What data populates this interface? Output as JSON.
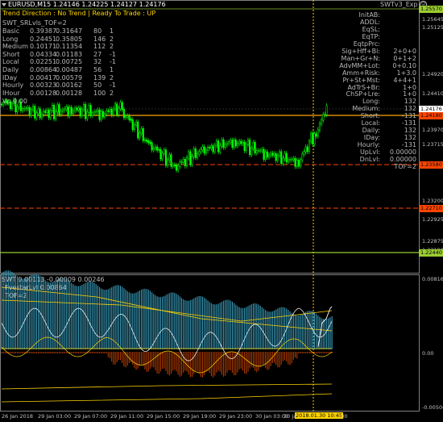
{
  "header": {
    "symbol_line": "EURUSD,M15  1.24146 1.24225 1.24127 1.24176",
    "trend_line": "Trend Direction : No Trend  |  Ready To Trade : UP",
    "indicator_name": "SWTv3_Exp",
    "swt_line": "SWT_SRLvls_TOF=2",
    "colors": {
      "trend": "#ffd400",
      "bull": "#00ff00",
      "bear": "#00c800"
    }
  },
  "stats_table": [
    [
      "Basic",
      "0.39387",
      "0.31647",
      "80",
      "1"
    ],
    [
      "Long",
      "0.24451",
      "0.35805",
      "146",
      "2"
    ],
    [
      "Medium",
      "0.10171",
      "0.11354",
      "112",
      "2"
    ],
    [
      "Short",
      "0.04334",
      "0.01183",
      "27",
      "-1"
    ],
    [
      "Local",
      "0.02251",
      "0.00725",
      "32",
      "-1"
    ],
    [
      "Daily",
      "0.00864",
      "0.00487",
      "56",
      "1"
    ],
    [
      "IDay",
      "0.00417",
      "0.00579",
      "139",
      "2"
    ],
    [
      "Hourly",
      "0.00323",
      "0.00162",
      "50",
      "-1"
    ],
    [
      "IHour",
      "0.00128",
      "0.00128",
      "100",
      "2"
    ]
  ],
  "vp_line": "Vp 0.00",
  "right_panel": [
    {
      "label": "InitAB:",
      "value": ""
    },
    {
      "label": "ADDL:",
      "value": ""
    },
    {
      "label": "EqSL:",
      "value": ""
    },
    {
      "label": "EqTP:",
      "value": ""
    },
    {
      "label": "EqtpPrc:",
      "value": ""
    },
    {
      "label": "Sig+Hff+Bi:",
      "value": "2+0+0"
    },
    {
      "label": "Man+Gr+N:",
      "value": "0+1+2"
    },
    {
      "label": "AdvMM+Lot:",
      "value": "0+0.10"
    },
    {
      "label": "Amm+Risk:",
      "value": "1+3.0"
    },
    {
      "label": "Pr+St+Mst:",
      "value": "4+4+1"
    },
    {
      "label": "AdTrS+Br:",
      "value": "1+0"
    },
    {
      "label": "ChSP+Lre:",
      "value": "1+0"
    },
    {
      "label": "Long:",
      "value": "132"
    },
    {
      "label": "Medium:",
      "value": "132"
    },
    {
      "label": "Short:",
      "value": "-131"
    },
    {
      "label": "Local:",
      "value": "-131"
    },
    {
      "label": "Daily:",
      "value": "132"
    },
    {
      "label": "IDay:",
      "value": "132"
    },
    {
      "label": "Hourly:",
      "value": "-131"
    },
    {
      "label": "UpLvl:",
      "value": "0.00000"
    },
    {
      "label": "DnLvl:",
      "value": "0.00000"
    },
    {
      "label": "",
      "value": "TOF=2"
    }
  ],
  "price_axis": {
    "ticks": [
      "1.25645",
      "1.25125",
      "1.24920",
      "1.24410",
      "1.23970",
      "1.23715",
      "1.23200",
      "1.22925",
      "1.22875",
      "1.22190"
    ],
    "labels": [
      {
        "text": "1.25570",
        "color": "#9acd32"
      },
      {
        "text": "1.24176",
        "color": "#ffffff"
      },
      {
        "text": "1.24180",
        "color": "#ff4500"
      },
      {
        "text": "1.23580",
        "color": "#ff4500"
      },
      {
        "text": "1.22710",
        "color": "#ff4500"
      },
      {
        "text": "1.22440",
        "color": "#9acd32"
      }
    ]
  },
  "subwindow": {
    "title": "SWT 0.00113 -0.00009 0.00246",
    "line2": "FvestarLvl 0.00864",
    "line3": "TOF=2",
    "ticks": [
      "0.00816",
      "0.00",
      "-0.00504"
    ]
  },
  "time_axis": {
    "labels": [
      "26 Jan 2018",
      "29 Jan 03:00",
      "29 Jan 07:00",
      "29 Jan 11:00",
      "29 Jan 15:00",
      "29 Jan 19:00",
      "29 Jan 23:00",
      "30 Jan 03:00",
      "30 Ja"
    ],
    "cursor_label": "2018.01.30 10:45",
    "cursor_suffix": ":00"
  },
  "icons": {
    "smile": "smiley-icon"
  }
}
